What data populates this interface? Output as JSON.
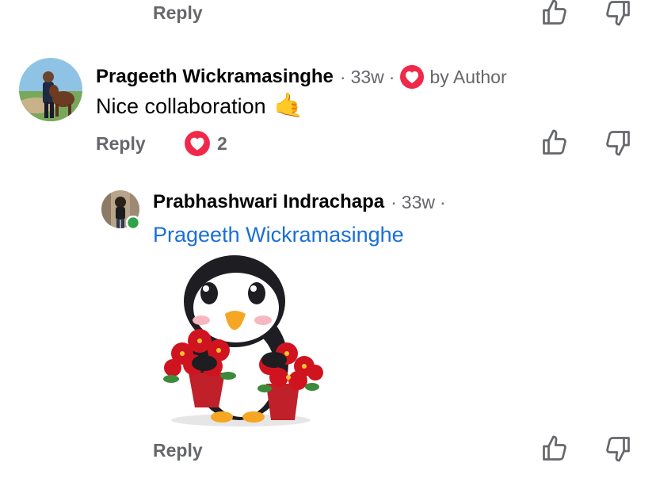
{
  "top_actions": {
    "reply_label": "Reply"
  },
  "comment1": {
    "author": "Prageeth Wickramasinghe",
    "time": "33w",
    "sep": "·",
    "author_badge": "by Author",
    "text": "Nice collaboration",
    "emoji": "🤙",
    "reply_label": "Reply",
    "reaction_count": "2",
    "reaction_color": "#f0284a"
  },
  "reply1": {
    "author": "Prabhashwari Indrachapa",
    "time": "33w",
    "sep": "·",
    "mention": "Prageeth Wickramasinghe",
    "sticker": "penguin-poinsettia-sticker",
    "reply_label": "Reply",
    "online_color": "#31a24c"
  },
  "colors": {
    "mention": "#1a6ed8",
    "muted": "#65676b",
    "text": "#050505"
  }
}
